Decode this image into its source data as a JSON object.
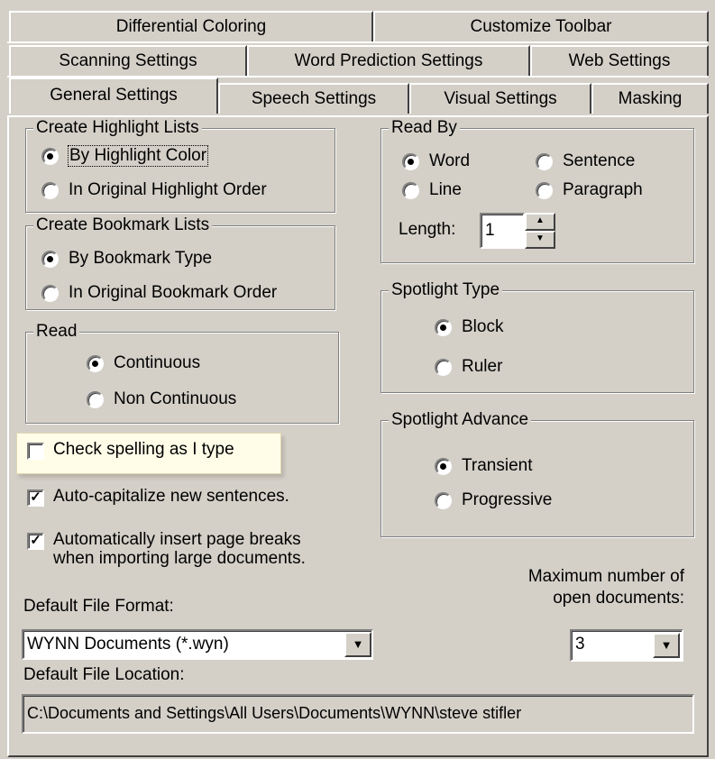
{
  "tabs": {
    "row1": [
      "Differential Coloring",
      "Customize Toolbar"
    ],
    "row2": [
      "Scanning Settings",
      "Word Prediction Settings",
      "Web Settings"
    ],
    "row3": [
      "General Settings",
      "Speech Settings",
      "Visual Settings",
      "Masking"
    ]
  },
  "highlight_lists": {
    "legend": "Create Highlight Lists",
    "opt1": "By Highlight Color",
    "opt2": "In Original Highlight Order"
  },
  "bookmark_lists": {
    "legend": "Create Bookmark Lists",
    "opt1": "By Bookmark Type",
    "opt2": "In Original Bookmark Order"
  },
  "read": {
    "legend": "Read",
    "opt1": "Continuous",
    "opt2": "Non Continuous"
  },
  "read_by": {
    "legend": "Read By",
    "word": "Word",
    "sentence": "Sentence",
    "line": "Line",
    "paragraph": "Paragraph",
    "length_label": "Length:",
    "length_value": "1"
  },
  "spotlight_type": {
    "legend": "Spotlight Type",
    "opt1": "Block",
    "opt2": "Ruler"
  },
  "spotlight_advance": {
    "legend": "Spotlight Advance",
    "opt1": "Transient",
    "opt2": "Progressive"
  },
  "checks": {
    "spelling": "Check spelling as I type",
    "autocap": "Auto-capitalize new sentences.",
    "pagebreaks_line1": "Automatically insert page breaks",
    "pagebreaks_line2": "when importing large documents."
  },
  "file_format": {
    "label": "Default File Format:",
    "value": "WYNN Documents (*.wyn)"
  },
  "max_docs": {
    "label_line1": "Maximum number of",
    "label_line2": "open documents:",
    "value": "3"
  },
  "file_location": {
    "label": "Default File Location:",
    "value": "C:\\Documents and Settings\\All Users\\Documents\\WYNN\\steve stifler"
  }
}
